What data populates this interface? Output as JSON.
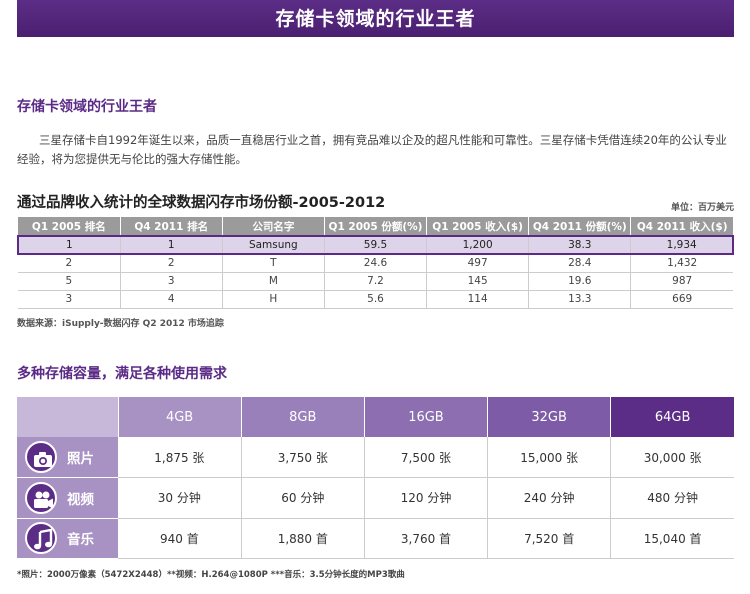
{
  "banner": {
    "title": "存储卡领域的行业王者"
  },
  "intro": {
    "heading": "存储卡领域的行业王者",
    "text": "三星存储卡自1992年诞生以来，品质一直稳居行业之首，拥有竞品难以企及的超凡性能和可靠性。三星存储卡凭借连续20年的公认专业经验，将为您提供无与伦比的强大存储性能。"
  },
  "market": {
    "heading": "通过品牌收入统计的全球数据闪存市场份额-2005-2012",
    "unit": "单位：百万美元",
    "columns": [
      "Q1 2005 排名",
      "Q4 2011 排名",
      "公司名字",
      "Q1 2005 份额(%)",
      "Q1 2005 收入($)",
      "Q4 2011 份额(%)",
      "Q4 2011 收入($)"
    ],
    "rows": [
      [
        "1",
        "1",
        "Samsung",
        "59.5",
        "1,200",
        "38.3",
        "1,934"
      ],
      [
        "2",
        "2",
        "T",
        "24.6",
        "497",
        "28.4",
        "1,432"
      ],
      [
        "5",
        "3",
        "M",
        "7.2",
        "145",
        "19.6",
        "987"
      ],
      [
        "3",
        "4",
        "H",
        "5.6",
        "114",
        "13.3",
        "669"
      ]
    ],
    "source": "数据来源：iSupply-数据闪存 Q2 2012 市场追踪"
  },
  "capacity": {
    "heading": "多种存储容量，满足各种使用需求",
    "sizes": [
      "4GB",
      "8GB",
      "16GB",
      "32GB",
      "64GB"
    ],
    "rows": [
      {
        "label": "照片",
        "icon": "camera-icon",
        "values": [
          "1,875 张",
          "3,750 张",
          "7,500 张",
          "15,000 张",
          "30,000 张"
        ]
      },
      {
        "label": "视频",
        "icon": "video-camera-icon",
        "values": [
          "30 分钟",
          "60 分钟",
          "120 分钟",
          "240 分钟",
          "480 分钟"
        ]
      },
      {
        "label": "音乐",
        "icon": "music-note-icon",
        "values": [
          "940 首",
          "1,880 首",
          "3,760 首",
          "7,520 首",
          "15,040 首"
        ]
      }
    ],
    "footnote": "*照片：2000万像素（5472X2448）**视频：H.264@1080P ***音乐：3.5分钟长度的MP3歌曲"
  }
}
